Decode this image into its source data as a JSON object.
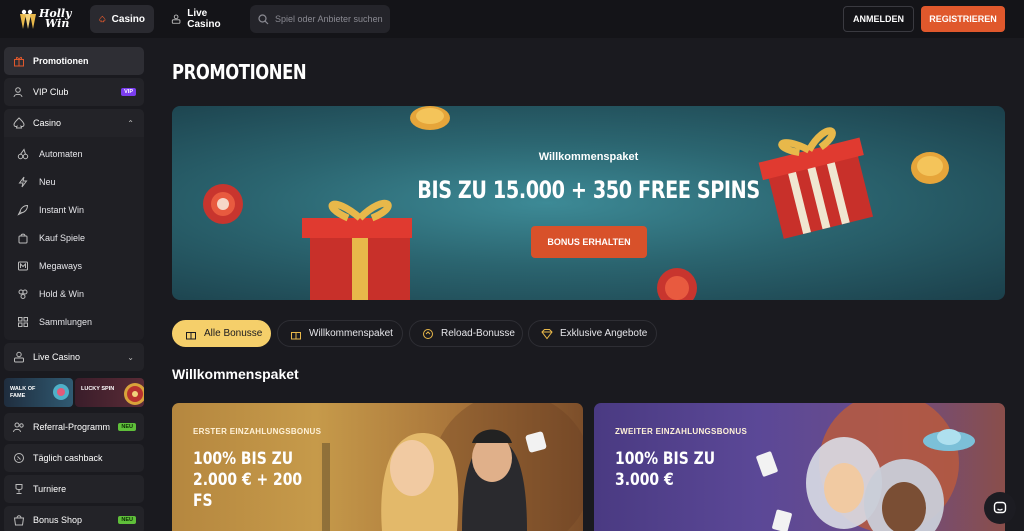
{
  "header": {
    "logo_line1": "Holly",
    "logo_line2": "Win",
    "nav": [
      {
        "label": "Casino",
        "icon": "spade-icon"
      },
      {
        "label": "Live Casino",
        "icon": "dealer-icon"
      }
    ],
    "search_placeholder": "Spiel oder Anbieter suchen",
    "login_label": "ANMELDEN",
    "register_label": "REGISTRIEREN"
  },
  "sidebar": {
    "promotions": "Promotionen",
    "vip_club": "VIP Club",
    "vip_badge": "VIP",
    "casino": "Casino",
    "casino_items": [
      "Automaten",
      "Neu",
      "Instant Win",
      "Kauf Spiele",
      "Megaways",
      "Hold & Win",
      "Sammlungen"
    ],
    "live_casino": "Live Casino",
    "tile_wof": "WALK OF FAME",
    "tile_lucky": "LUCKY SPIN",
    "referral": "Referral-Programm",
    "referral_badge": "NEU",
    "cashback": "Täglich cashback",
    "tournaments": "Turniere",
    "bonus_shop": "Bonus Shop",
    "bonus_shop_badge": "NEU"
  },
  "main": {
    "page_title": "PROMOTIONEN",
    "hero": {
      "subtitle": "Willkommenspaket",
      "title": "BIS ZU 15.000 + 350 FREE SPINS",
      "button": "BONUS ERHALTEN"
    },
    "filters": [
      "Alle Bonusse",
      "Willkommenspaket",
      "Reload-Bonusse",
      "Exklusive Angebote"
    ],
    "section_title": "Willkommenspaket",
    "cards": [
      {
        "kicker": "ERSTER EINZAHLUNGSBONUS",
        "title_line1": "100% BIS ZU",
        "title_line2": "2.000 € + 200 FS"
      },
      {
        "kicker": "ZWEITER EINZAHLUNGSBONUS",
        "title_line1": "100% BIS ZU",
        "title_line2": "3.000 €"
      }
    ]
  },
  "colors": {
    "accent": "#e0582c",
    "chip_active": "#f5cf6a",
    "background": "#1a1a1f"
  }
}
